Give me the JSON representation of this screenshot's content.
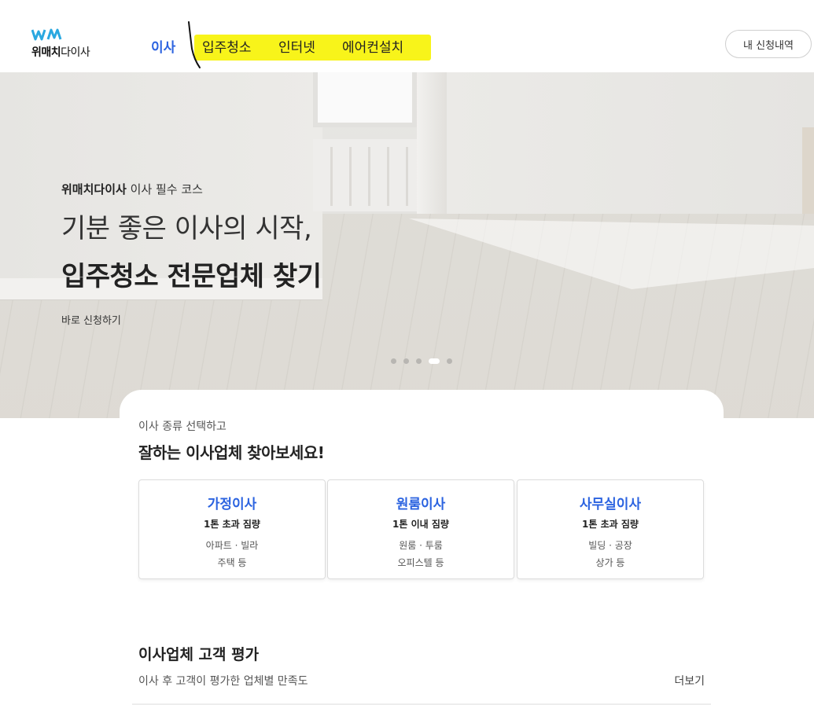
{
  "header": {
    "logo_bold": "위매치",
    "logo_rest": "다이사",
    "nav": [
      {
        "label": "이사",
        "active": true
      },
      {
        "label": "입주청소",
        "active": false
      },
      {
        "label": "인터넷",
        "active": false
      },
      {
        "label": "에어컨설치",
        "active": false
      }
    ],
    "my_requests": "내 신청내역",
    "accent_color": "#2b63e0",
    "highlight_color": "#f8f41a"
  },
  "hero": {
    "sub_bold": "위매치다이사",
    "sub_rest": " 이사 필수 코스",
    "title_line1": "기분 좋은 이사의 시작,",
    "title_line2": "입주청소 전문업체 찾기",
    "cta": "바로 신청하기",
    "slides_total": 5,
    "slide_active": 4
  },
  "moving_types": {
    "subtitle": "이사 종류 선택하고",
    "title": "잘하는 이사업체 찾아보세요!",
    "cards": [
      {
        "name": "가정이사",
        "weight": "1톤 초과 짐량",
        "desc1": "아파트 · 빌라",
        "desc2": "주택 등"
      },
      {
        "name": "원룸이사",
        "weight": "1톤 이내 짐량",
        "desc1": "원룸 · 투룸",
        "desc2": "오피스텔 등"
      },
      {
        "name": "사무실이사",
        "weight": "1톤 초과 짐량",
        "desc1": "빌딩 · 공장",
        "desc2": "상가 등"
      }
    ]
  },
  "reviews": {
    "title": "이사업체 고객 평가",
    "subtitle": "이사 후 고객이 평가한 업체별 만족도",
    "more": "더보기"
  }
}
